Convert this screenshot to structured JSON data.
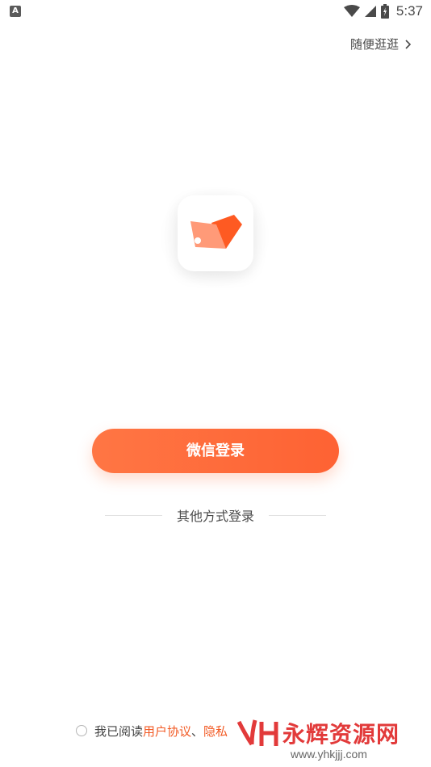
{
  "status_bar": {
    "notification_badge": "A",
    "time": "5:37"
  },
  "header": {
    "browse_label": "随便逛逛"
  },
  "main": {
    "wechat_login_label": "微信登录",
    "other_methods_label": "其他方式登录"
  },
  "agreement": {
    "prefix": "我已阅读",
    "user_agreement": "用户协议",
    "separator": "、",
    "privacy_policy": "隐私"
  },
  "watermark": {
    "brand": "永辉资源网",
    "url": "www.yhkjjj.com"
  },
  "colors": {
    "accent": "#ff6a3a",
    "link": "#f25a24"
  }
}
